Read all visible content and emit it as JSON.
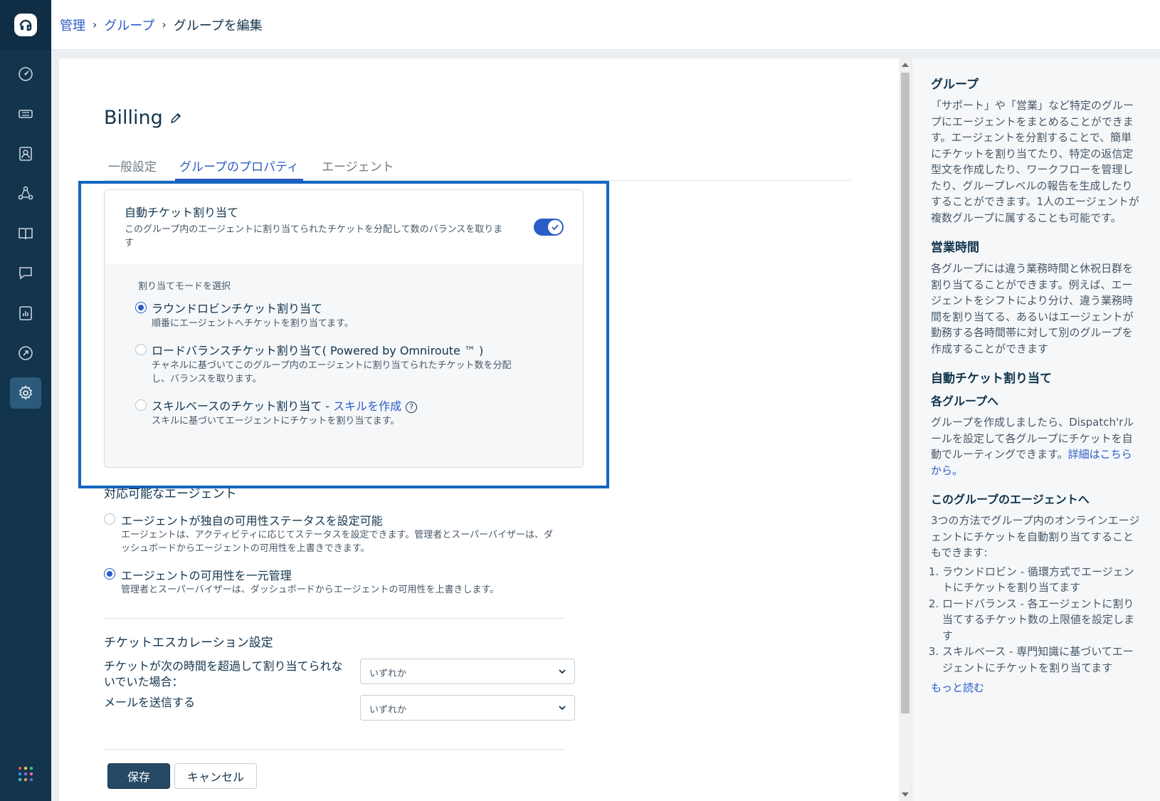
{
  "breadcrumb": {
    "items": [
      "管理",
      "グループ"
    ],
    "current": "グループを編集",
    "separator": "›"
  },
  "page": {
    "title": "Billing"
  },
  "tabs": [
    {
      "label": "一般設定",
      "active": false
    },
    {
      "label": "グループのプロパティ",
      "active": true
    },
    {
      "label": "エージェント",
      "active": false
    }
  ],
  "auto_assign": {
    "title": "自動チケット割り当て",
    "description": "このグループ内のエージェントに割り当てられたチケットを分配して数のバランスを取ります",
    "enabled": true,
    "mode_label": "割り当てモードを選択",
    "options": [
      {
        "title": "ラウンドロビンチケット割り当て",
        "description": "順番にエージェントへチケットを割り当てます。",
        "checked": true
      },
      {
        "title": "ロードバランスチケット割り当て( Powered by Omniroute ™ )",
        "description": "チャネルに基づいてこのグループ内のエージェントに割り当てられたチケット数を分配し、バランスを取ります。",
        "checked": false
      },
      {
        "title": "スキルベースのチケット割り当て - ",
        "link": "スキルを作成",
        "help_icon": "?",
        "description": "スキルに基づいてエージェントにチケットを割り当てます。",
        "checked": false
      }
    ]
  },
  "availability": {
    "title": "対応可能なエージェント",
    "options": [
      {
        "title": "エージェントが独自の可用性ステータスを設定可能",
        "description": "エージェントは、アクティビティに応じてステータスを設定できます。管理者とスーパーバイザーは、ダッシュボードからエージェントの可用性を上書きできます。",
        "checked": false
      },
      {
        "title": "エージェントの可用性を一元管理",
        "description": "管理者とスーパーバイザーは、ダッシュボードからエージェントの可用性を上書きします。",
        "checked": true
      }
    ]
  },
  "escalation": {
    "title": "チケットエスカレーション設定",
    "unassigned_label": "チケットが次の時間を超過して割り当てられないでいた場合：",
    "unassigned_value": "いずれか",
    "email_label": "メールを送信する",
    "email_value": "いずれか"
  },
  "actions": {
    "save": "保存",
    "cancel": "キャンセル"
  },
  "help_panel": {
    "groups_title": "グループ",
    "groups_text": "「サポート」や「営業」など特定のグループにエージェントをまとめることができます。エージェントを分割することで、簡単にチケットを割り当てたり、特定の返信定型文を作成したり、ワークフローを管理したり、グループレベルの報告を生成したりすることができます。1人のエージェントが複数グループに属することも可能です。",
    "hours_title": "営業時間",
    "hours_text": "各グループには違う業務時間と休祝日群を割り当てることができます。例えば、エージェントをシフトにより分け、違う業務時間を割り当てる、あるいはエージェントが勤務する各時間帯に対して別のグループを作成することができます",
    "auto_title": "自動チケット割り当て",
    "each_group_title": "各グループへ",
    "each_group_text": "グループを作成しましたら、Dispatch'rルールを設定して各グループにチケットを自動でルーティングできます。",
    "each_group_link": "詳細はこちらから。",
    "agents_title": "このグループのエージェントへ",
    "agents_text": "3つの方法でグループ内のオンラインエージェントにチケットを自動割り当てすることもできます:",
    "agents_list": [
      "ラウンドロビン - 循環方式でエージェントにチケットを割り当てます",
      "ロードバランス - 各エージェントに割り当てするチケット数の上限値を設定します",
      "スキルベース - 専門知識に基づいてエージェントにチケットを割り当てます"
    ],
    "read_more": "もっと読む"
  },
  "colors": {
    "sidebar": "#12344d",
    "accent": "#2c5cc5",
    "highlight": "#1566c0"
  },
  "icons": {
    "sidebar": [
      "dashboard-icon",
      "tickets-icon",
      "contacts-icon",
      "groups-icon",
      "knowledge-base-icon",
      "forums-icon",
      "analytics-icon",
      "admin-icon",
      "settings-icon"
    ]
  }
}
